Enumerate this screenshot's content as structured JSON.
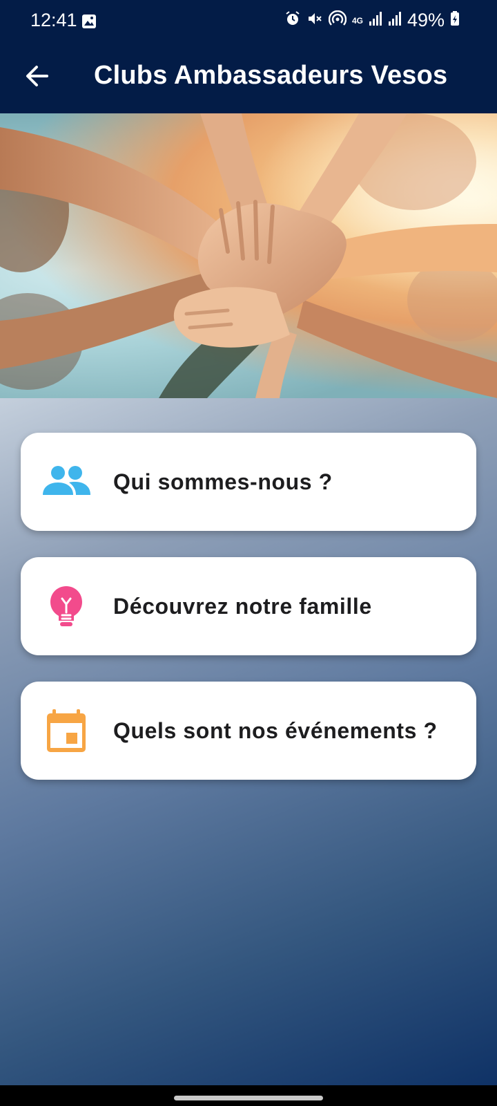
{
  "status_bar": {
    "time": "12:41",
    "battery": "49%",
    "network": "4G",
    "icons": [
      "gallery-icon",
      "alarm-icon",
      "mute-icon",
      "hotspot-icon",
      "signal-icon",
      "signal-icon",
      "battery-icon"
    ]
  },
  "app_bar": {
    "title": "Clubs Ambassadeurs Vesos",
    "back_icon": "arrow-left-icon"
  },
  "hero": {
    "image": "hands-stacked-together-photo"
  },
  "menu": {
    "items": [
      {
        "label": "Qui sommes-nous ?",
        "icon": "people-icon",
        "color": "#3fb5ec"
      },
      {
        "label": "Découvrez notre famille",
        "icon": "lightbulb-icon",
        "color": "#f24b8c"
      },
      {
        "label": "Quels sont nos événements ?",
        "icon": "calendar-icon",
        "color": "#f7a544"
      }
    ]
  },
  "colors": {
    "appbar": "#031c47",
    "card": "#ffffff"
  }
}
